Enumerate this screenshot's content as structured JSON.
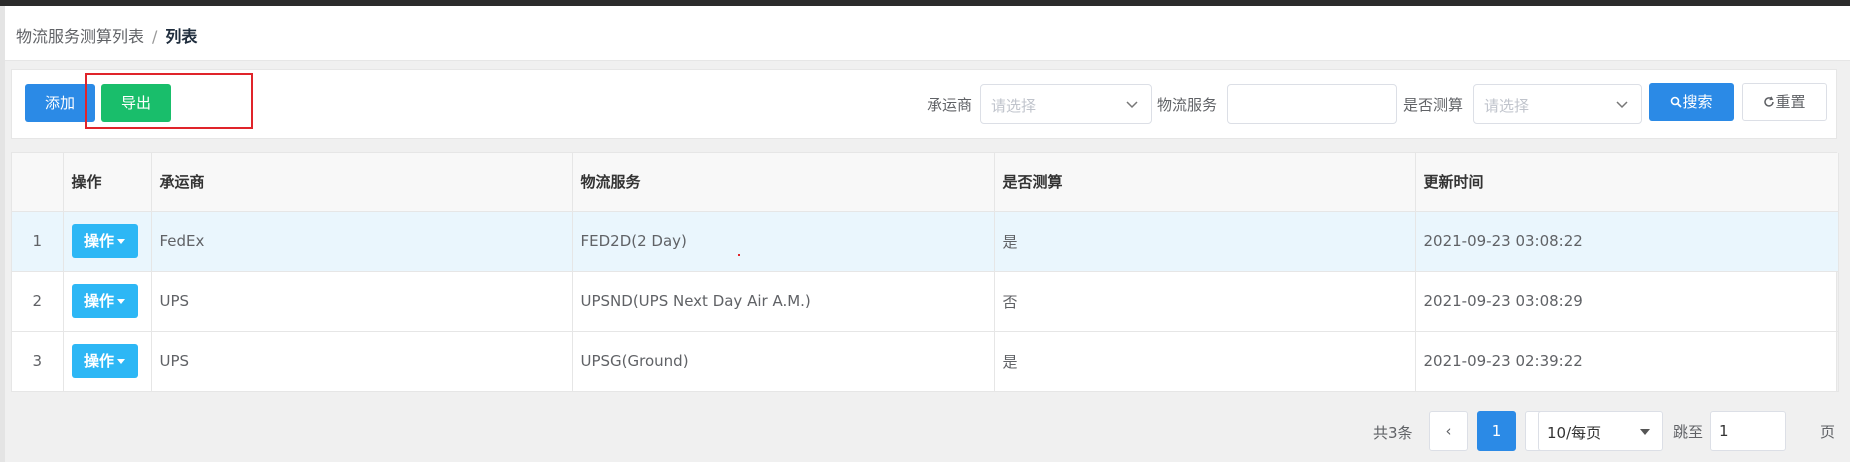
{
  "breadcrumb": {
    "parent": "物流服务测算列表",
    "separator": "/",
    "current": "列表"
  },
  "toolbar": {
    "add_label": "添加",
    "export_label": "导出",
    "carrier_label": "承运商",
    "carrier_placeholder": "请选择",
    "service_label": "物流服务",
    "service_value": "",
    "calc_label": "是否测算",
    "calc_placeholder": "请选择",
    "search_label": "搜索",
    "reset_label": "重置"
  },
  "table": {
    "headers": [
      "",
      "操作",
      "承运商",
      "物流服务",
      "是否测算",
      "更新时间"
    ],
    "op_label": "操作",
    "rows": [
      {
        "index": "1",
        "carrier": "FedEx",
        "service": "FED2D(2 Day)",
        "calc": "是",
        "updated": "2021-09-23 03:08:22"
      },
      {
        "index": "2",
        "carrier": "UPS",
        "service": "UPSND(UPS Next Day Air A.M.)",
        "calc": "否",
        "updated": "2021-09-23 03:08:29"
      },
      {
        "index": "3",
        "carrier": "UPS",
        "service": "UPSG(Ground)",
        "calc": "是",
        "updated": "2021-09-23 02:39:22"
      }
    ]
  },
  "pagination": {
    "total": "共3条",
    "prev": "‹",
    "current_page": "1",
    "next": "›",
    "page_size": "10/每页",
    "jump_label": "跳至",
    "jump_value": "1",
    "page_unit": "页"
  },
  "colors": {
    "primary": "#2b8ae6",
    "success": "#19be6b",
    "info": "#2db7f5",
    "highlight": "#e0242a"
  }
}
